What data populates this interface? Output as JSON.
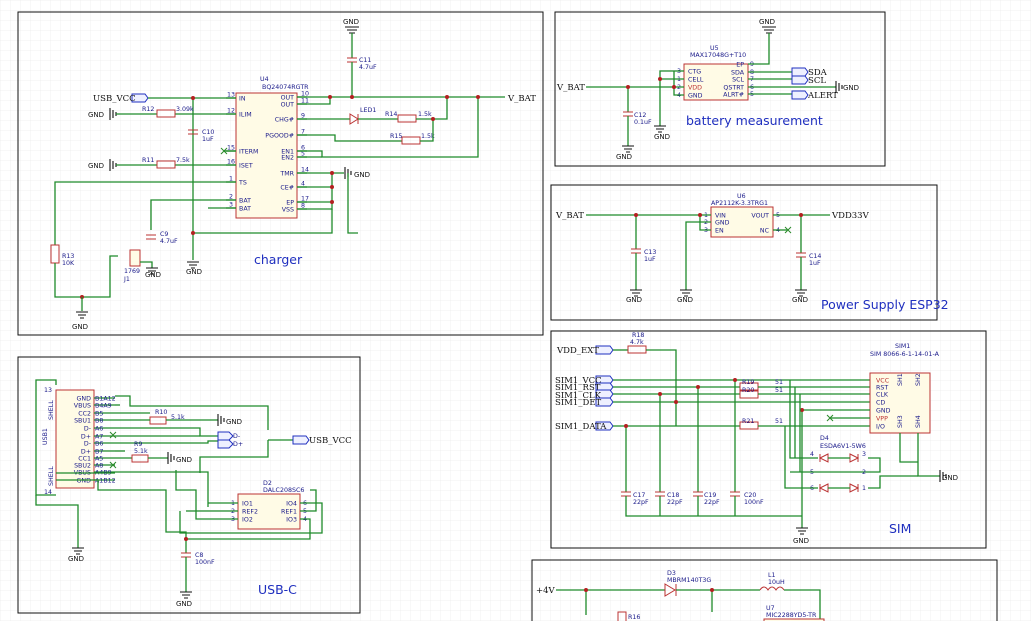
{
  "blocks": {
    "charger": "charger",
    "battery": "battery measurement",
    "power": "Power Supply ESP32",
    "usbc": "USB-C",
    "sim": "SIM"
  },
  "nets": {
    "gnd": "GND",
    "usb_vcc": "USB_VCC",
    "v_bat": "V_BAT",
    "vdd33": "VDD33V",
    "sda": "SDA",
    "scl": "SCL",
    "alert": "ALERT",
    "vdd_ext": "VDD_EXT",
    "sim1_vcc": "SIM1_VCC",
    "sim1_rst": "SIM1_RST",
    "sim1_clk": "SIM1_CLK",
    "sim1_det": "SIM1_DET",
    "sim1_data": "SIM1_DATA",
    "plus4v": "+4V"
  },
  "charger": {
    "u4_ref": "U4",
    "u4_part": "BQ24074RGTR",
    "pins_left": [
      {
        "num": "13",
        "name": "IN"
      },
      {
        "num": "12",
        "name": "ILIM"
      },
      {
        "num": "15",
        "name": "ITERM"
      },
      {
        "num": "16",
        "name": "ISET"
      },
      {
        "num": "1",
        "name": "TS"
      },
      {
        "num": "2",
        "name": "BAT"
      },
      {
        "num": "3",
        "name": "BAT"
      }
    ],
    "pins_right": [
      {
        "num": "10",
        "name": "OUT"
      },
      {
        "num": "11",
        "name": "OUT"
      },
      {
        "num": "9",
        "name": "CHG#"
      },
      {
        "num": "7",
        "name": "PGOOD#"
      },
      {
        "num": "6",
        "name": "EN1"
      },
      {
        "num": "5",
        "name": "EN2"
      },
      {
        "num": "14",
        "name": "TMR"
      },
      {
        "num": "4",
        "name": "CE#"
      },
      {
        "num": "17",
        "name": "EP"
      },
      {
        "num": "8",
        "name": "VSS"
      }
    ],
    "r12": {
      "ref": "R12",
      "val": "3.09k"
    },
    "r11": {
      "ref": "R11",
      "val": "7.5k"
    },
    "r14": {
      "ref": "R14",
      "val": "1.5k"
    },
    "r15": {
      "ref": "R15",
      "val": "1.5k"
    },
    "r13": {
      "ref": "R13",
      "val": "10K"
    },
    "c10": {
      "ref": "C10",
      "val": "1uF"
    },
    "c11": {
      "ref": "C11",
      "val": "4.7uF"
    },
    "c9": {
      "ref": "C9",
      "val": "4.7uF"
    },
    "led1": "LED1",
    "j1": {
      "ref": "J1",
      "part": "1769"
    }
  },
  "battery": {
    "u5_ref": "U5",
    "u5_part": "MAX17048G+T10",
    "pins_left": [
      {
        "num": "3",
        "name": "CTG"
      },
      {
        "num": "1",
        "name": "CELL"
      },
      {
        "num": "2",
        "name": "VDD"
      },
      {
        "num": "4",
        "name": "GND"
      }
    ],
    "pins_right": [
      {
        "num": "9",
        "name": "EP"
      },
      {
        "num": "8",
        "name": "SDA"
      },
      {
        "num": "7",
        "name": "SCL"
      },
      {
        "num": "6",
        "name": "QSTRT"
      },
      {
        "num": "5",
        "name": "ALRT#"
      }
    ],
    "c12": {
      "ref": "C12",
      "val": "0.1uF"
    }
  },
  "power": {
    "u6_ref": "U6",
    "u6_part": "AP2112K-3.3TRG1",
    "pins_left": [
      {
        "num": "1",
        "name": "VIN"
      },
      {
        "num": "2",
        "name": "GND"
      },
      {
        "num": "3",
        "name": "EN"
      }
    ],
    "pins_right": [
      {
        "num": "5",
        "name": "VOUT"
      },
      {
        "num": "4",
        "name": "NC"
      }
    ],
    "c13": {
      "ref": "C13",
      "val": "1uF"
    },
    "c14": {
      "ref": "C14",
      "val": "1uF"
    }
  },
  "usbc": {
    "usb1": "USB1",
    "pins_left": [
      "GND",
      "VBUS",
      "CC2",
      "SBU1",
      "D-",
      "D+",
      "D-",
      "D+",
      "CC1",
      "SBU2",
      "VBUS",
      "GND"
    ],
    "pins_right": [
      "B1A12",
      "B4A9",
      "B5",
      "B8",
      "A6",
      "A7",
      "B6",
      "B7",
      "A5",
      "A8",
      "A4B9",
      "A1B12"
    ],
    "shell_top": "SHELL",
    "shell_bot": "SHELL",
    "shell_num_top": "13",
    "shell_num_bot": "14",
    "r10": {
      "ref": "R10",
      "val": "5.1k"
    },
    "r9": {
      "ref": "R9",
      "val": "5.1k"
    },
    "c8": {
      "ref": "C8",
      "val": "100nF"
    },
    "d2_ref": "D2",
    "d2_part": "DALC208SC6",
    "d2_pins_left": [
      {
        "num": "1",
        "name": "IO1"
      },
      {
        "num": "2",
        "name": "REF2"
      },
      {
        "num": "3",
        "name": "IO2"
      }
    ],
    "d2_pins_right": [
      {
        "num": "6",
        "name": "IO4"
      },
      {
        "num": "5",
        "name": "REF1"
      },
      {
        "num": "4",
        "name": "IO3"
      }
    ],
    "dm": "D-",
    "dp": "D+"
  },
  "sim": {
    "r18": {
      "ref": "R18",
      "val": "4.7k"
    },
    "r19": {
      "ref": "R19",
      "val": "51"
    },
    "r20": {
      "ref": "R20",
      "val": "51"
    },
    "r21": {
      "ref": "R21",
      "val": "51"
    },
    "c17": {
      "ref": "C17",
      "val": "22pF"
    },
    "c18": {
      "ref": "C18",
      "val": "22pF"
    },
    "c19": {
      "ref": "C19",
      "val": "22pF"
    },
    "c20": {
      "ref": "C20",
      "val": "100nF"
    },
    "sim1_ref": "SIM1",
    "sim1_part": "SIM 8066-6-1-14-01-A",
    "pins": [
      "VCC",
      "RST",
      "CLK",
      "CD",
      "GND",
      "VPP",
      "I/O"
    ],
    "shells": [
      "SH1",
      "SH2",
      "SH3",
      "SH4"
    ],
    "d4_ref": "D4",
    "d4_part": "ESDA6V1-5W6",
    "d4_pins": [
      "4",
      "3",
      "5",
      "2",
      "6",
      "1"
    ]
  },
  "bottom": {
    "d3": {
      "ref": "D3",
      "part": "MBRM140T3G"
    },
    "l1": {
      "ref": "L1",
      "val": "10uH"
    },
    "u7": {
      "ref": "U7",
      "part": "MIC2288YD5-TR"
    },
    "r16": "R16"
  }
}
